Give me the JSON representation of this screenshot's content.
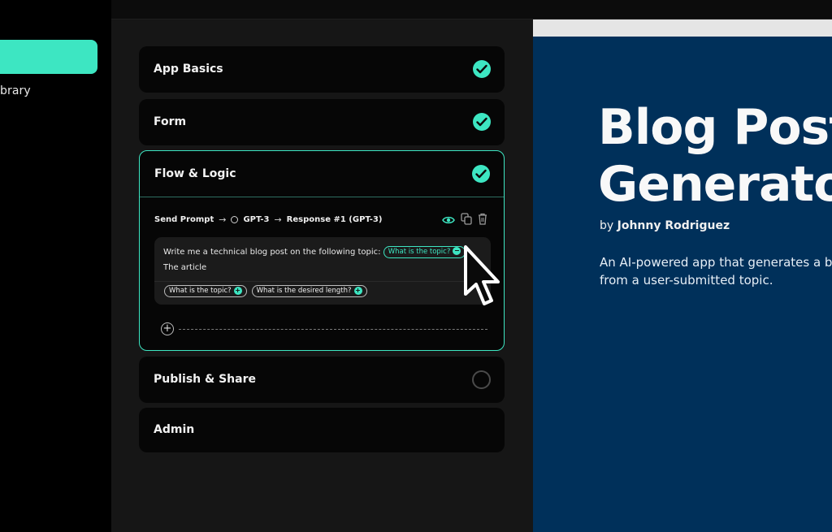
{
  "sidebar": {
    "library_label": "brary"
  },
  "sections": [
    {
      "title": "App Basics",
      "status": "done"
    },
    {
      "title": "Form",
      "status": "done"
    },
    {
      "title": "Flow & Logic",
      "status": "done"
    },
    {
      "title": "Publish & Share",
      "status": "pending"
    },
    {
      "title": "Admin",
      "status": "none"
    }
  ],
  "flow": {
    "steps": [
      "Send Prompt",
      "GPT-3",
      "Response #1 (GPT-3)"
    ],
    "prompt_text_1": "Write me a technical blog post on the following topic:",
    "prompt_var_inline": "What is the topic?",
    "prompt_text_2": "The article",
    "variables": [
      "What is the topic?",
      "What is the desired length?"
    ]
  },
  "preview": {
    "title_line1": "Blog Post",
    "title_line2": "Generato",
    "by_prefix": "by",
    "author": "Johnny Rodriguez",
    "desc_line1": "An AI-powered app that generates a b",
    "desc_line2": "from a user-submitted topic."
  },
  "colors": {
    "accent": "#3de6c2",
    "preview_bg": "#00305a"
  }
}
